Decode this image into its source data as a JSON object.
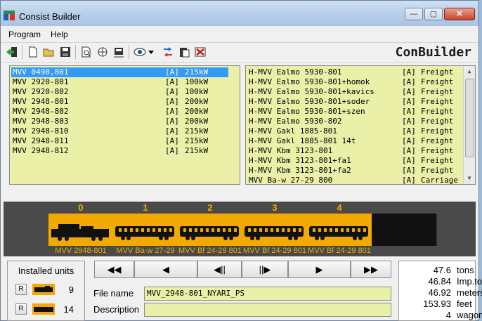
{
  "window": {
    "title": "Consist Builder"
  },
  "menu": [
    "Program",
    "Help"
  ],
  "toolbar": {
    "logo": "ConBuilder"
  },
  "engines": [
    {
      "name": "MVV 0490,801",
      "tag": "[A]",
      "power": "215kW",
      "selected": true
    },
    {
      "name": "MVV 2920-801",
      "tag": "[A]",
      "power": "100kW"
    },
    {
      "name": "MVV 2920-802",
      "tag": "[A]",
      "power": "100kW"
    },
    {
      "name": "MVV 2948-801",
      "tag": "[A]",
      "power": "200kW"
    },
    {
      "name": "MVV 2948-802",
      "tag": "[A]",
      "power": "200kW"
    },
    {
      "name": "MVV 2948-803",
      "tag": "[A]",
      "power": "200kW"
    },
    {
      "name": "MVV 2948-810",
      "tag": "[A]",
      "power": "215kW"
    },
    {
      "name": "MVV 2948-811",
      "tag": "[A]",
      "power": "215kW"
    },
    {
      "name": "MVV 2948-812",
      "tag": "[A]",
      "power": "215kW"
    }
  ],
  "wagons": [
    {
      "name": "H-MVV Ealmo 5930-801",
      "tag": "[A]",
      "type": "Freight"
    },
    {
      "name": "H-MVV Ealmo 5930-801+homok",
      "tag": "[A]",
      "type": "Freight"
    },
    {
      "name": "H-MVV Ealmo 5930-801+kavics",
      "tag": "[A]",
      "type": "Freight"
    },
    {
      "name": "H-MVV Ealmo 5930-801+soder",
      "tag": "[A]",
      "type": "Freight"
    },
    {
      "name": "H-MVV Ealmo 5930-801+szen",
      "tag": "[A]",
      "type": "Freight"
    },
    {
      "name": "H-MVV Ealmo 5930-802",
      "tag": "[A]",
      "type": "Freight"
    },
    {
      "name": "H-MVV Gakl 1885-801",
      "tag": "[A]",
      "type": "Freight"
    },
    {
      "name": "H-MVV Gakl 1885-801 14t",
      "tag": "[A]",
      "type": "Freight"
    },
    {
      "name": "H-MVV Kbm 3123-801",
      "tag": "[A]",
      "type": "Freight"
    },
    {
      "name": "H-MVV Kbm 3123-801+fa1",
      "tag": "[A]",
      "type": "Freight"
    },
    {
      "name": "H-MVV Kbm 3123-801+fa2",
      "tag": "[A]",
      "type": "Freight"
    },
    {
      "name": "MVV Ba-w 27-29 800",
      "tag": "[A]",
      "type": "Carriage"
    }
  ],
  "consist": [
    {
      "index": "0",
      "label": "MVV 2948-801",
      "kind": "loco"
    },
    {
      "index": "1",
      "label": "MVV Ba-w 27-29",
      "kind": "coach"
    },
    {
      "index": "2",
      "label": "MVV Bf 24-29 801",
      "kind": "coach"
    },
    {
      "index": "3",
      "label": "MVV Bf 24-29 801",
      "kind": "coach"
    },
    {
      "index": "4",
      "label": "MVV Bf 24-29 801",
      "kind": "coach"
    }
  ],
  "installed": {
    "title": "Installed units",
    "engines_count": "9",
    "wagons_count": "14",
    "r_label": "R"
  },
  "nav": [
    "◀◀",
    "◀",
    "◀||",
    "||▶",
    "▶",
    "▶▶"
  ],
  "form": {
    "file_label": "File name",
    "file_value": "MVV_2948-801_NYARI_PS",
    "desc_label": "Description",
    "desc_value": ""
  },
  "stats": [
    {
      "value": "47.6",
      "unit": "tons"
    },
    {
      "value": "46.84",
      "unit": "Imp.ton"
    },
    {
      "value": "46.92",
      "unit": "meters"
    },
    {
      "value": "153.93",
      "unit": "feet"
    },
    {
      "value": "4",
      "unit": "wagons"
    }
  ]
}
